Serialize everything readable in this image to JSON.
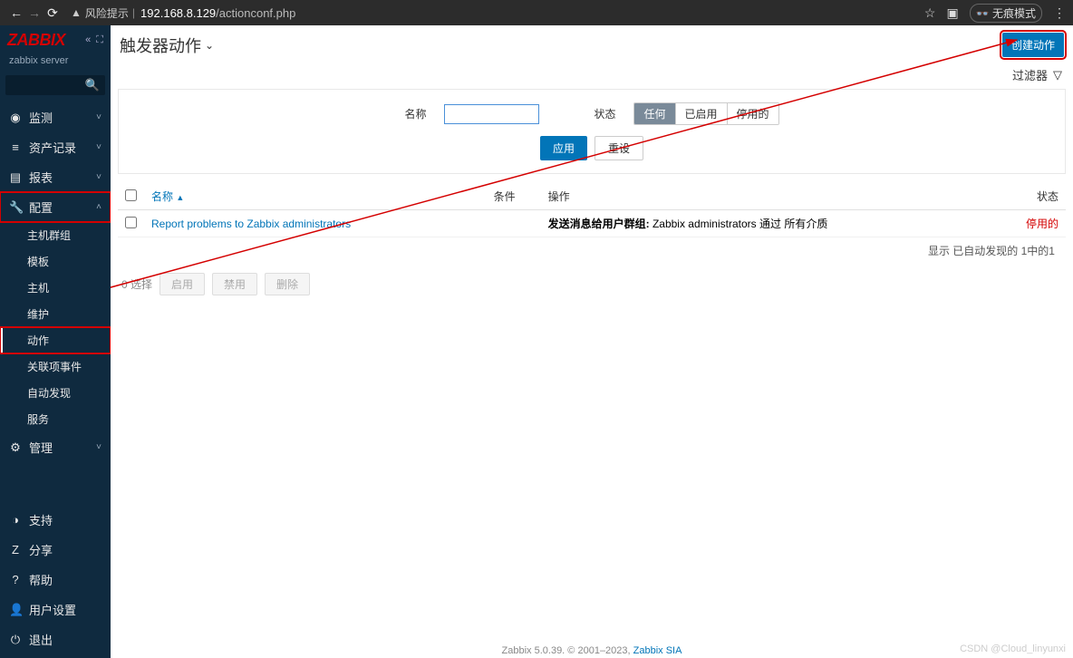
{
  "browser": {
    "warn_label": "风险提示",
    "url_host": "192.168.8.129",
    "url_path": "/actionconf.php",
    "incognito_label": "无痕模式"
  },
  "sidebar": {
    "logo": "ZABBIX",
    "server_name": "zabbix server",
    "items": [
      {
        "icon": "◉",
        "label": "监测",
        "chev": true
      },
      {
        "icon": "≡",
        "label": "资产记录",
        "chev": true
      },
      {
        "icon": "▤",
        "label": "报表",
        "chev": true
      },
      {
        "icon": "🔧",
        "label": "配置",
        "chev": true,
        "hilite": true,
        "expanded": true,
        "sub": [
          {
            "label": "主机群组"
          },
          {
            "label": "模板"
          },
          {
            "label": "主机"
          },
          {
            "label": "维护"
          },
          {
            "label": "动作",
            "active": true,
            "hilite": true
          },
          {
            "label": "关联项事件"
          },
          {
            "label": "自动发现"
          },
          {
            "label": "服务"
          }
        ]
      },
      {
        "icon": "⚙",
        "label": "管理",
        "chev": true
      }
    ],
    "bottom": [
      {
        "icon": "◑",
        "label": "支持"
      },
      {
        "icon": "Z",
        "label": "分享"
      },
      {
        "icon": "?",
        "label": "帮助"
      },
      {
        "icon": "👤",
        "label": "用户设置"
      },
      {
        "icon": "⏻",
        "label": "退出"
      }
    ]
  },
  "page": {
    "title": "触发器动作",
    "create_button": "创建动作",
    "filter_toggle": "过滤器"
  },
  "filter": {
    "name_label": "名称",
    "status_label": "状态",
    "status_options": [
      "任何",
      "已启用",
      "停用的"
    ],
    "status_active": "任何",
    "apply": "应用",
    "reset": "重设"
  },
  "table": {
    "cols": {
      "name": "名称",
      "condition": "条件",
      "operation": "操作",
      "status": "状态"
    },
    "sort_indicator": "▲",
    "rows": [
      {
        "name": "Report problems to Zabbix administrators",
        "operation_prefix": "发送消息给用户群组:",
        "operation_detail": " Zabbix administrators 通过 所有介质",
        "status": "停用的"
      }
    ],
    "footer": "显示 已自动发现的 1中的1"
  },
  "bulk": {
    "selected": "0 选择",
    "enable": "启用",
    "disable": "禁用",
    "delete": "删除"
  },
  "footer": {
    "text": "Zabbix 5.0.39. © 2001–2023, ",
    "link": "Zabbix SIA"
  },
  "watermark": "CSDN @Cloud_linyunxi"
}
